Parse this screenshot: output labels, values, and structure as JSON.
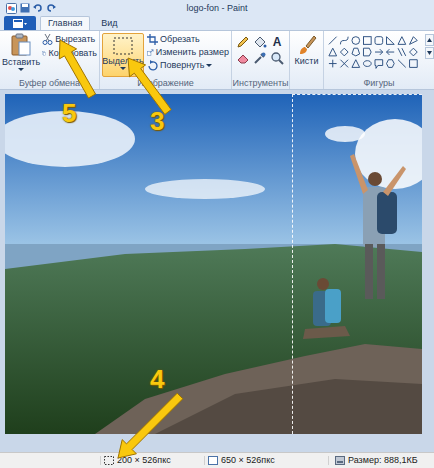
{
  "window": {
    "title": "logo-fon - Paint"
  },
  "tabs": [
    {
      "label": "Главная",
      "selected": true
    },
    {
      "label": "Вид",
      "selected": false
    }
  ],
  "ribbon": {
    "clipboard": {
      "label": "Буфер обмена",
      "paste": "Вставить",
      "cut": "Вырезать",
      "copy": "Копировать"
    },
    "image": {
      "label": "Изображение",
      "select": {
        "label": "Выделить",
        "selected": true
      },
      "crop": "Обрезать",
      "resize": "Изменить размер",
      "rotate": "Повернуть"
    },
    "tools": {
      "label": "Инструменты",
      "text_icon": "A"
    },
    "brushes": {
      "label": "Кисти"
    },
    "shapes": {
      "label": "Фигуры"
    }
  },
  "status_bar": {
    "selection": "200 × 526пкс",
    "image_size": "650 × 526пкс",
    "file_size": "Размер: 888,1КБ"
  },
  "annotations": [
    {
      "number": "5"
    },
    {
      "number": "3"
    },
    {
      "number": "4"
    }
  ]
}
